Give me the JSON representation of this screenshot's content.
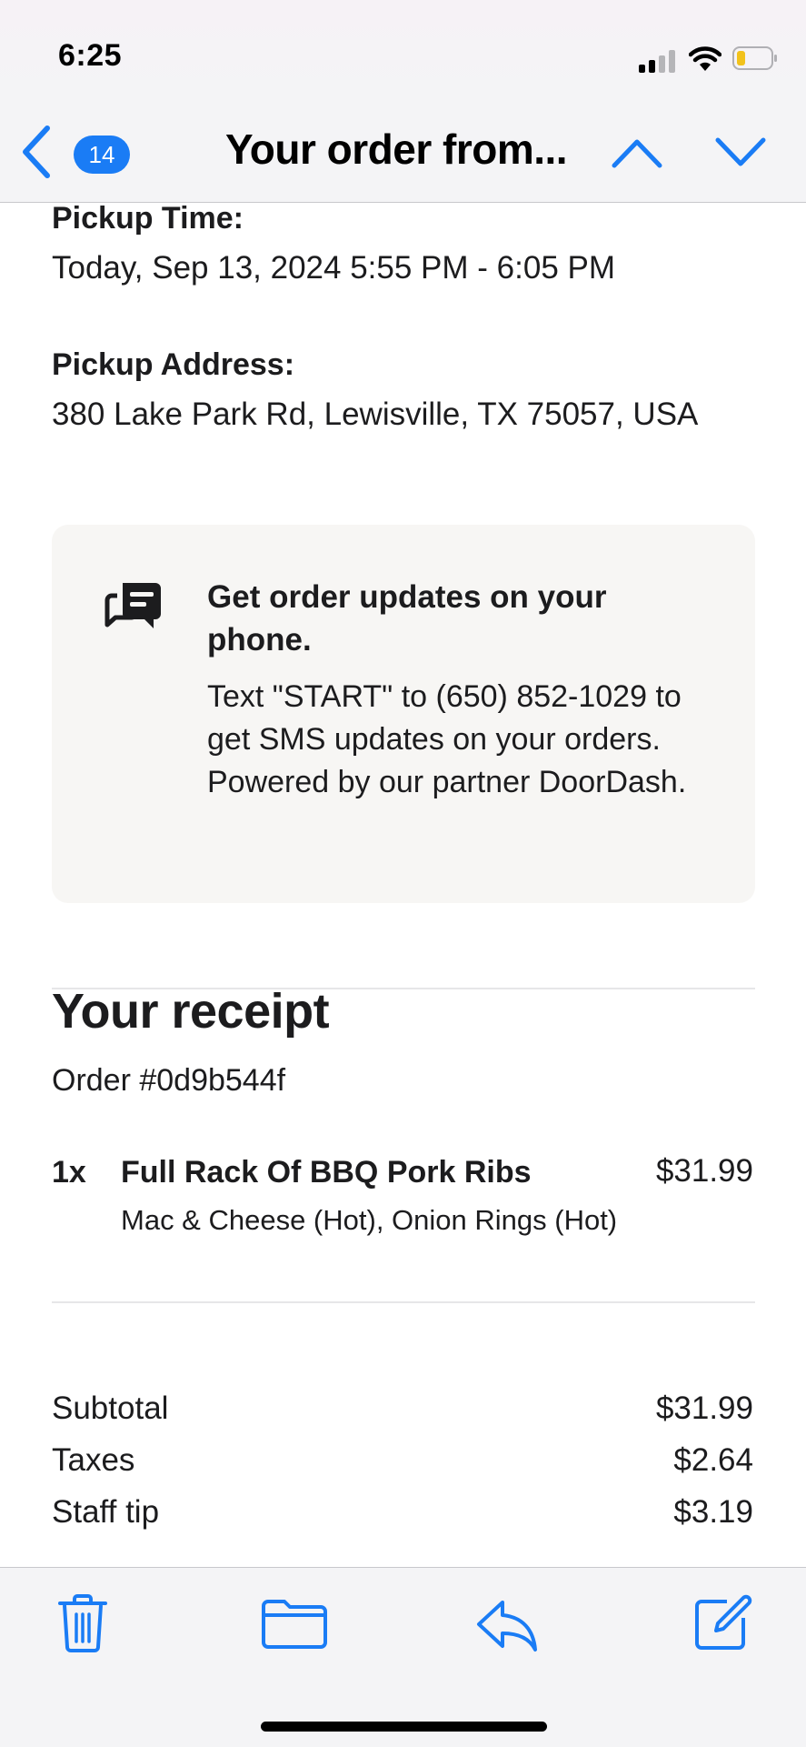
{
  "status_bar": {
    "time": "6:25"
  },
  "nav": {
    "unread_count": "14",
    "title": "Your order from..."
  },
  "pickup": {
    "time_label": "Pickup Time:",
    "time_value": "Today, Sep 13, 2024 5:55 PM - 6:05 PM",
    "address_label": "Pickup Address:",
    "address_value": "380 Lake Park Rd, Lewisville, TX 75057, USA"
  },
  "sms_card": {
    "title": "Get order updates on your phone.",
    "body": "Text \"START\" to (650) 852-1029 to get SMS updates on your orders. Powered by our partner DoorDash."
  },
  "receipt": {
    "title": "Your receipt",
    "order_number": "Order #0d9b544f",
    "items": [
      {
        "qty": "1x",
        "name": "Full Rack Of BBQ Pork Ribs",
        "price": "$31.99",
        "modifiers": "Mac & Cheese (Hot), Onion Rings (Hot)"
      }
    ],
    "summary": [
      {
        "label": "Subtotal",
        "value": "$31.99"
      },
      {
        "label": "Taxes",
        "value": "$2.64"
      },
      {
        "label": "Staff tip",
        "value": "$3.19"
      }
    ]
  },
  "colors": {
    "accent": "#1a7cf5",
    "card_bg": "#f7f6f4",
    "bar_bg": "#f4f4f6"
  },
  "icons": [
    "back-icon",
    "chevron-up-icon",
    "chevron-down-icon",
    "chat-icon",
    "trash-icon",
    "folder-icon",
    "reply-icon",
    "compose-icon"
  ]
}
